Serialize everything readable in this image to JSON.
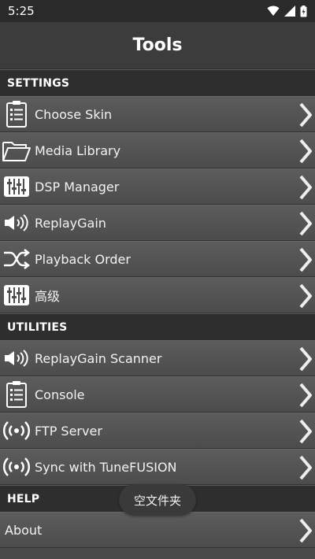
{
  "status_bar": {
    "time": "5:25",
    "icons": [
      "wifi-icon",
      "signal-icon",
      "battery-icon"
    ]
  },
  "header": {
    "title": "Tools"
  },
  "sections": {
    "settings": {
      "title": "SETTINGS",
      "items": [
        {
          "label": "Choose Skin",
          "icon": "clipboard-list-icon"
        },
        {
          "label": "Media Library",
          "icon": "folder-open-icon"
        },
        {
          "label": "DSP Manager",
          "icon": "equalizer-icon"
        },
        {
          "label": "ReplayGain",
          "icon": "speaker-volume-icon"
        },
        {
          "label": "Playback Order",
          "icon": "shuffle-icon"
        },
        {
          "label": "高级",
          "icon": "equalizer-icon"
        }
      ]
    },
    "utilities": {
      "title": "UTILITIES",
      "items": [
        {
          "label": "ReplayGain Scanner",
          "icon": "speaker-volume-icon"
        },
        {
          "label": "Console",
          "icon": "clipboard-list-icon"
        },
        {
          "label": "FTP Server",
          "icon": "broadcast-icon"
        },
        {
          "label": "Sync with TuneFUSION",
          "icon": "broadcast-icon"
        }
      ]
    },
    "help": {
      "title": "HELP",
      "items": [
        {
          "label": "About"
        }
      ]
    }
  },
  "toast": {
    "text": "空文件夹"
  }
}
